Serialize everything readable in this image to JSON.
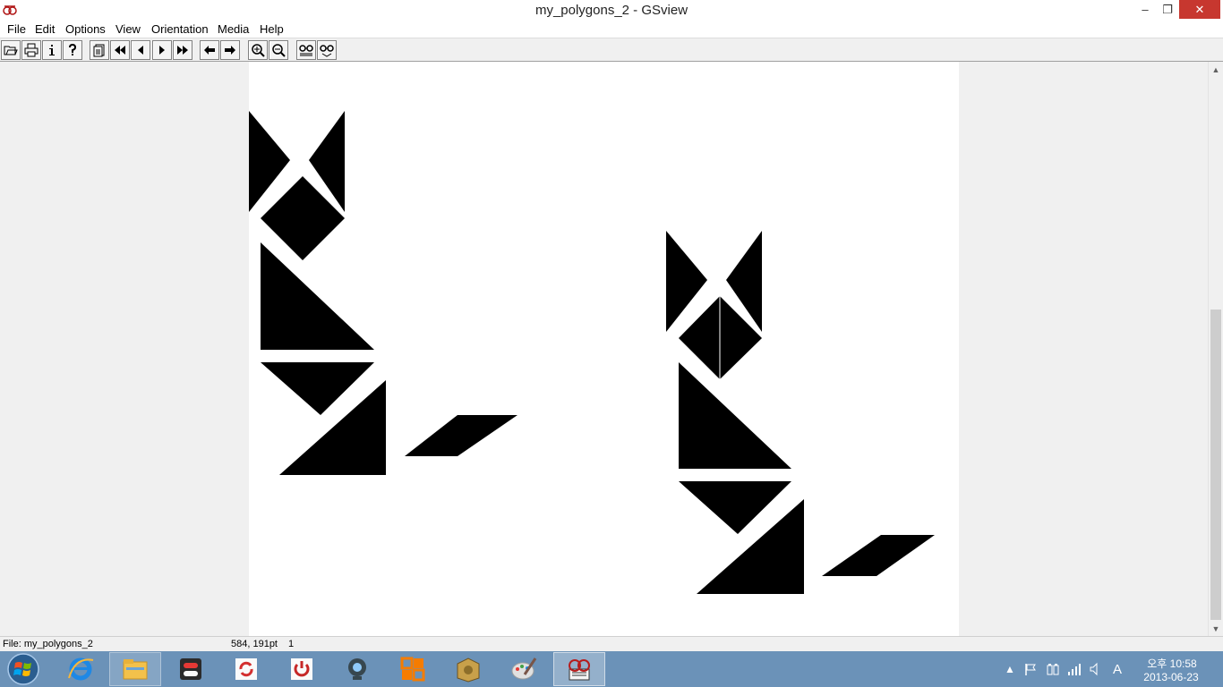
{
  "window": {
    "title": "my_polygons_2 - GSview",
    "controls": {
      "minimize": "–",
      "maximize": "❐",
      "close": "✕"
    }
  },
  "menubar": {
    "items": [
      "File",
      "Edit",
      "Options",
      "View",
      "Orientation",
      "Media",
      "Help"
    ]
  },
  "toolbar": {
    "buttons": [
      "open-icon",
      "print-icon",
      "info-icon",
      "help-icon",
      "goto-page-icon",
      "first-page-icon",
      "prev-page-icon",
      "next-page-icon",
      "last-page-icon",
      "back-icon",
      "forward-icon",
      "zoom-in-icon",
      "zoom-out-icon",
      "search-icon",
      "search-next-icon"
    ]
  },
  "document": {
    "fill_color": "#000000",
    "page_color": "#ffffff"
  },
  "statusbar": {
    "file": "File: my_polygons_2",
    "coords": "584, 191pt",
    "page": "1"
  },
  "taskbar": {
    "background": "#6b92b8",
    "apps": [
      "start-orb",
      "internet-explorer",
      "file-explorer",
      "app-toggle",
      "app-sync",
      "app-power",
      "app-webcam",
      "app-office",
      "app-archive",
      "app-paint",
      "app-gsview"
    ]
  },
  "tray": {
    "time": "오후 10:58",
    "date": "2013-06-23",
    "ime": "A"
  }
}
